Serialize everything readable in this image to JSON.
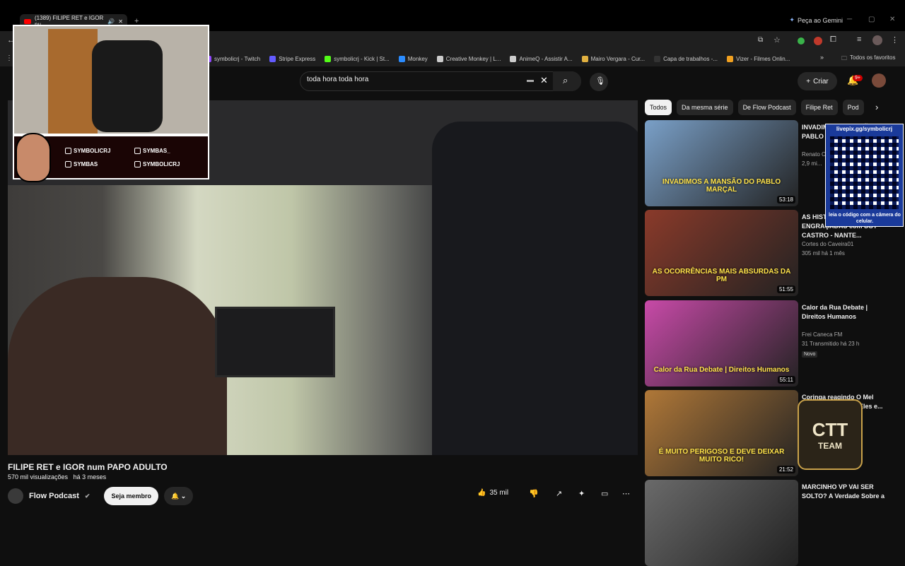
{
  "browser": {
    "tab_title": "(1389) FILIPE RET e IGOR nu...",
    "gemini_label": "Peça ao Gemini"
  },
  "bookmarks": [
    {
      "label": "symbolicrj - Twitch",
      "color": "#9146ff"
    },
    {
      "label": "Stripe Express",
      "color": "#635bff"
    },
    {
      "label": "symbolicrj - Kick | St...",
      "color": "#53fc18"
    },
    {
      "label": "Monkey",
      "color": "#2b8cff"
    },
    {
      "label": "Creative Monkey | L...",
      "color": "#cccccc"
    },
    {
      "label": "AnimeQ - Assistir A...",
      "color": "#cccccc"
    },
    {
      "label": "Mairo Vergara - Cur...",
      "color": "#e0b040"
    },
    {
      "label": "Capa de trabalhos -...",
      "color": "#333333"
    },
    {
      "label": "Vizer - Filmes Onlin...",
      "color": "#f0a020"
    }
  ],
  "bookmarks_all": "Todos os favoritos",
  "youtube": {
    "search_value": "toda hora toda hora",
    "create_label": "Criar",
    "notif_badge": "9+"
  },
  "overlay": {
    "socials": [
      "SYMBOLICRJ",
      "SYMBAS_",
      "SYMBAS",
      "SYMBOLICRJ"
    ],
    "qr_title": "livepix.gg/symbolicrj",
    "qr_caption": "leia o código com a câmera do celular.",
    "ctt_line1": "CTT",
    "ctt_line2": "TEAM"
  },
  "video": {
    "title": "FILIPE RET e IGOR num PAPO ADULTO",
    "views": "570 mil visualizações",
    "age": "há 3 meses",
    "channel": "Flow Podcast",
    "member_label": "Seja membro",
    "likes": "35 mil"
  },
  "chips": [
    "Todos",
    "Da mesma série",
    "De Flow Podcast",
    "Filipe Ret",
    "Pod"
  ],
  "recommendations": [
    {
      "title": "INVADIMOS A MANSÃO DO PABLO MARÇAL",
      "channel": "Renato C...",
      "meta": "2,9 mi...",
      "duration": "53:18",
      "thumb_text": "INVADIMOS A MANSÃO DO PABLO MARÇAL",
      "color": "#7aa0c8"
    },
    {
      "title": "AS HISTÓRIAS MAIS ENGRAÇADAS com SGT CASTRO - NANTE...",
      "channel": "Cortes do Caveira01",
      "meta": "305 mil  há 1 mês",
      "duration": "51:55",
      "thumb_text": "AS OCORRÊNCIAS MAIS ABSURDAS DA PM",
      "color": "#8a3a2a"
    },
    {
      "title": "Calor da Rua Debate | Direitos Humanos",
      "channel": "Frei Caneca FM",
      "meta": "31  Transmitido há 23 h",
      "duration": "55:11",
      "badge": "Novo",
      "thumb_text": "Calor da Rua Debate | Direitos Humanos",
      "color": "#c84aa8"
    },
    {
      "title": "Coringa reagindo O Mel Alucin... do Nepal (Eles e... ...louquecer)",
      "channel": "",
      "meta": "",
      "duration": "21:52",
      "thumb_text": "É MUITO PERIGOSO E DEVE DEIXAR MUITO RICO!",
      "color": "#b07838"
    },
    {
      "title": "MARCINHO VP VAI SER SOLTO? A Verdade Sobre a",
      "channel": "",
      "meta": "",
      "duration": "",
      "thumb_text": "",
      "color": "#6a6a6a"
    }
  ]
}
